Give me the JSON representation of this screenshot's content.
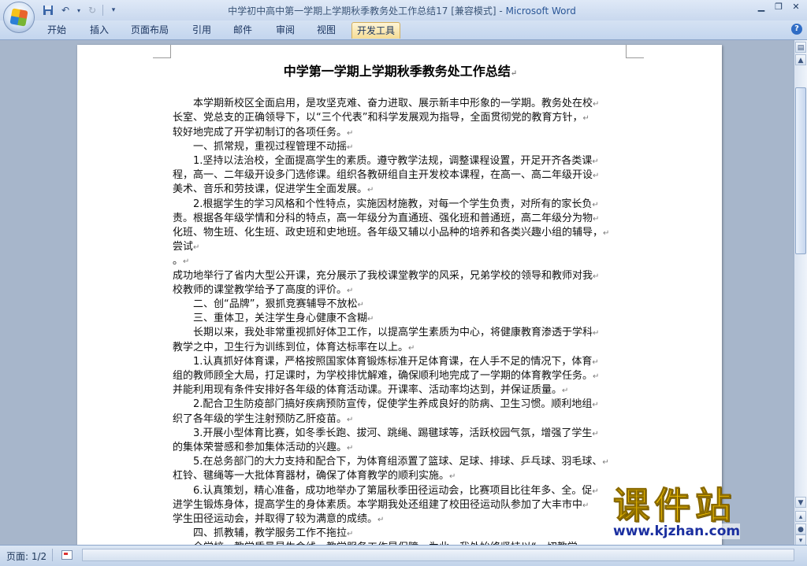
{
  "window": {
    "doc_name": "中学初中高中第一学期上学期秋季教务处工作总结17 [兼容模式]",
    "separator": " - ",
    "app_name": "Microsoft Word"
  },
  "ribbon": {
    "tabs": [
      {
        "label": "开始",
        "active": false
      },
      {
        "label": "插入",
        "active": false
      },
      {
        "label": "页面布局",
        "active": false
      },
      {
        "label": "引用",
        "active": false
      },
      {
        "label": "邮件",
        "active": false
      },
      {
        "label": "审阅",
        "active": false
      },
      {
        "label": "视图",
        "active": false
      },
      {
        "label": "开发工具",
        "active": true
      }
    ],
    "help_glyph": "?"
  },
  "document": {
    "title": "中学第一学期上学期秋季教务处工作总结",
    "lines": [
      "",
      "　　本学期新校区全面启用，是攻坚克难、奋力进取、展示新丰中形象的一学期。教务处在校",
      "长室、党总支的正确领导下，以“三个代表”和科学发展观为指导，全面贯彻党的教育方针，",
      "较好地完成了开学初制订的各项任务。",
      "　　一、抓常规，重视过程管理不动摇",
      "　　1.坚持以法治校，全面提高学生的素质。遵守教学法规，调整课程设置，开足开齐各类课",
      "程，高一、二年级开设多门选修课。组织各教研组自主开发校本课程，在高一、高二年级开设",
      "美术、音乐和劳技课，促进学生全面发展。",
      "　　2.根据学生的学习风格和个性特点，实施因材施教，对每一个学生负责，对所有的家长负",
      "责。根据各年级学情和分科的特点，高一年级分为直通班、强化班和普通班，高二年级分为物",
      "化班、物生班、化生班、政史班和史地班。各年级又辅以小品种的培养和各类兴趣小组的辅导，",
      "尝试",
      "。",
      "成功地举行了省内大型公开课，充分展示了我校课堂教学的风采，兄弟学校的领导和教师对我",
      "校教师的课堂教学给予了高度的评价。",
      "　　二、创“品牌”，狠抓竞赛辅导不放松",
      "　　三、重体卫，关注学生身心健康不含糊",
      "　　长期以来，我处非常重视抓好体卫工作，以提高学生素质为中心，将健康教育渗透于学科",
      "教学之中，卫生行为训练到位，体育达标率在以上。",
      "　　1.认真抓好体育课，严格按照国家体育锻炼标准开足体育课，在人手不足的情况下，体育",
      "组的教师顾全大局，打足课时，为学校排忧解难，确保顺利地完成了一学期的体育教学任务。",
      "并能利用现有条件安排好各年级的体育活动课。开课率、活动率均达到，并保证质量。",
      "　　2.配合卫生防疫部门搞好疾病预防宣传，促使学生养成良好的防病、卫生习惯。顺利地组",
      "织了各年级的学生注射预防乙肝疫苗。",
      "　　3.开展小型体育比赛，如冬季长跑、拔河、跳绳、踢毽球等，活跃校园气氛，增强了学生",
      "的集体荣誉感和参加集体活动的兴趣。",
      "　　5.在总务部门的大力支持和配合下，为体育组添置了篮球、足球、排球、乒乓球、羽毛球、",
      "杠铃、毽绳等一大批体育器材，确保了体育教学的顺利实施。",
      "　　6.认真策划，精心准备，成功地举办了第届秋季田径运动会，比赛项目比往年多、全。促",
      "进学生锻炼身体，提高学生的身体素质。本学期我处还组建了校田径运动队参加了大丰市中",
      "学生田径运动会，并取得了较为满意的成绩。",
      "　　四、抓教辅，教学服务工作不拖拉",
      "　　全学校，教学质量是生命线，教学服务工作是保障。为此，我处始终坚持以“一切教学"
    ]
  },
  "statusbar": {
    "page_label": "页面: 1/2"
  },
  "watermark": {
    "cn": "课件站",
    "url": "www.kjzhan.com"
  }
}
